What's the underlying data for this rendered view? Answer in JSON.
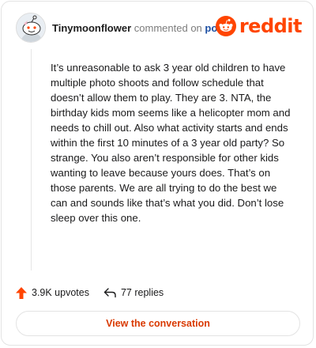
{
  "comment": {
    "username": "Tinymoonflower",
    "verb": "commented on",
    "target": "post",
    "body": "It’s unreasonable to ask 3 year old children to have multiple photo shoots and follow schedule that doesn’t allow them to play. They are 3. NTA, the birthday kids mom seems like a helicopter mom and needs to chill out. Also what activity starts and ends within the first 10 minutes of a 3 year old party? So strange. You also aren’t responsible for other kids wanting to leave because yours does. That’s on those parents. We are all trying to do the best we can and sounds like that’s what you did. Don’t lose sleep over this one."
  },
  "brand": {
    "name": "reddit",
    "icon": "reddit-logo-icon",
    "color": "#ff4500"
  },
  "stats": {
    "upvotes": "3.9K upvotes",
    "upvote_icon": "upvote-arrow-icon",
    "replies": "77 replies",
    "reply_icon": "reply-arrow-icon"
  },
  "cta": {
    "label": "View the conversation"
  },
  "colors": {
    "accent": "#ff4500",
    "link": "#1c4fa3",
    "cta_text": "#d93900"
  }
}
